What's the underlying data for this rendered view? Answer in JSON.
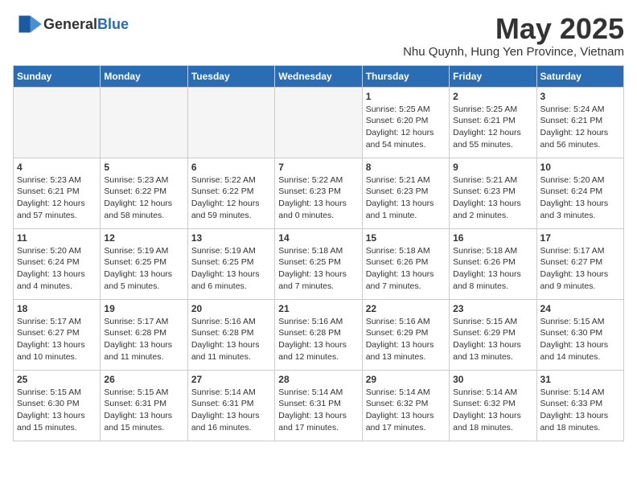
{
  "header": {
    "logo_general": "General",
    "logo_blue": "Blue",
    "month": "May 2025",
    "location": "Nhu Quynh, Hung Yen Province, Vietnam"
  },
  "weekdays": [
    "Sunday",
    "Monday",
    "Tuesday",
    "Wednesday",
    "Thursday",
    "Friday",
    "Saturday"
  ],
  "weeks": [
    [
      {
        "day": "",
        "info": ""
      },
      {
        "day": "",
        "info": ""
      },
      {
        "day": "",
        "info": ""
      },
      {
        "day": "",
        "info": ""
      },
      {
        "day": "1",
        "info": "Sunrise: 5:25 AM\nSunset: 6:20 PM\nDaylight: 12 hours\nand 54 minutes."
      },
      {
        "day": "2",
        "info": "Sunrise: 5:25 AM\nSunset: 6:21 PM\nDaylight: 12 hours\nand 55 minutes."
      },
      {
        "day": "3",
        "info": "Sunrise: 5:24 AM\nSunset: 6:21 PM\nDaylight: 12 hours\nand 56 minutes."
      }
    ],
    [
      {
        "day": "4",
        "info": "Sunrise: 5:23 AM\nSunset: 6:21 PM\nDaylight: 12 hours\nand 57 minutes."
      },
      {
        "day": "5",
        "info": "Sunrise: 5:23 AM\nSunset: 6:22 PM\nDaylight: 12 hours\nand 58 minutes."
      },
      {
        "day": "6",
        "info": "Sunrise: 5:22 AM\nSunset: 6:22 PM\nDaylight: 12 hours\nand 59 minutes."
      },
      {
        "day": "7",
        "info": "Sunrise: 5:22 AM\nSunset: 6:23 PM\nDaylight: 13 hours\nand 0 minutes."
      },
      {
        "day": "8",
        "info": "Sunrise: 5:21 AM\nSunset: 6:23 PM\nDaylight: 13 hours\nand 1 minute."
      },
      {
        "day": "9",
        "info": "Sunrise: 5:21 AM\nSunset: 6:23 PM\nDaylight: 13 hours\nand 2 minutes."
      },
      {
        "day": "10",
        "info": "Sunrise: 5:20 AM\nSunset: 6:24 PM\nDaylight: 13 hours\nand 3 minutes."
      }
    ],
    [
      {
        "day": "11",
        "info": "Sunrise: 5:20 AM\nSunset: 6:24 PM\nDaylight: 13 hours\nand 4 minutes."
      },
      {
        "day": "12",
        "info": "Sunrise: 5:19 AM\nSunset: 6:25 PM\nDaylight: 13 hours\nand 5 minutes."
      },
      {
        "day": "13",
        "info": "Sunrise: 5:19 AM\nSunset: 6:25 PM\nDaylight: 13 hours\nand 6 minutes."
      },
      {
        "day": "14",
        "info": "Sunrise: 5:18 AM\nSunset: 6:25 PM\nDaylight: 13 hours\nand 7 minutes."
      },
      {
        "day": "15",
        "info": "Sunrise: 5:18 AM\nSunset: 6:26 PM\nDaylight: 13 hours\nand 7 minutes."
      },
      {
        "day": "16",
        "info": "Sunrise: 5:18 AM\nSunset: 6:26 PM\nDaylight: 13 hours\nand 8 minutes."
      },
      {
        "day": "17",
        "info": "Sunrise: 5:17 AM\nSunset: 6:27 PM\nDaylight: 13 hours\nand 9 minutes."
      }
    ],
    [
      {
        "day": "18",
        "info": "Sunrise: 5:17 AM\nSunset: 6:27 PM\nDaylight: 13 hours\nand 10 minutes."
      },
      {
        "day": "19",
        "info": "Sunrise: 5:17 AM\nSunset: 6:28 PM\nDaylight: 13 hours\nand 11 minutes."
      },
      {
        "day": "20",
        "info": "Sunrise: 5:16 AM\nSunset: 6:28 PM\nDaylight: 13 hours\nand 11 minutes."
      },
      {
        "day": "21",
        "info": "Sunrise: 5:16 AM\nSunset: 6:28 PM\nDaylight: 13 hours\nand 12 minutes."
      },
      {
        "day": "22",
        "info": "Sunrise: 5:16 AM\nSunset: 6:29 PM\nDaylight: 13 hours\nand 13 minutes."
      },
      {
        "day": "23",
        "info": "Sunrise: 5:15 AM\nSunset: 6:29 PM\nDaylight: 13 hours\nand 13 minutes."
      },
      {
        "day": "24",
        "info": "Sunrise: 5:15 AM\nSunset: 6:30 PM\nDaylight: 13 hours\nand 14 minutes."
      }
    ],
    [
      {
        "day": "25",
        "info": "Sunrise: 5:15 AM\nSunset: 6:30 PM\nDaylight: 13 hours\nand 15 minutes."
      },
      {
        "day": "26",
        "info": "Sunrise: 5:15 AM\nSunset: 6:31 PM\nDaylight: 13 hours\nand 15 minutes."
      },
      {
        "day": "27",
        "info": "Sunrise: 5:14 AM\nSunset: 6:31 PM\nDaylight: 13 hours\nand 16 minutes."
      },
      {
        "day": "28",
        "info": "Sunrise: 5:14 AM\nSunset: 6:31 PM\nDaylight: 13 hours\nand 17 minutes."
      },
      {
        "day": "29",
        "info": "Sunrise: 5:14 AM\nSunset: 6:32 PM\nDaylight: 13 hours\nand 17 minutes."
      },
      {
        "day": "30",
        "info": "Sunrise: 5:14 AM\nSunset: 6:32 PM\nDaylight: 13 hours\nand 18 minutes."
      },
      {
        "day": "31",
        "info": "Sunrise: 5:14 AM\nSunset: 6:33 PM\nDaylight: 13 hours\nand 18 minutes."
      }
    ]
  ]
}
